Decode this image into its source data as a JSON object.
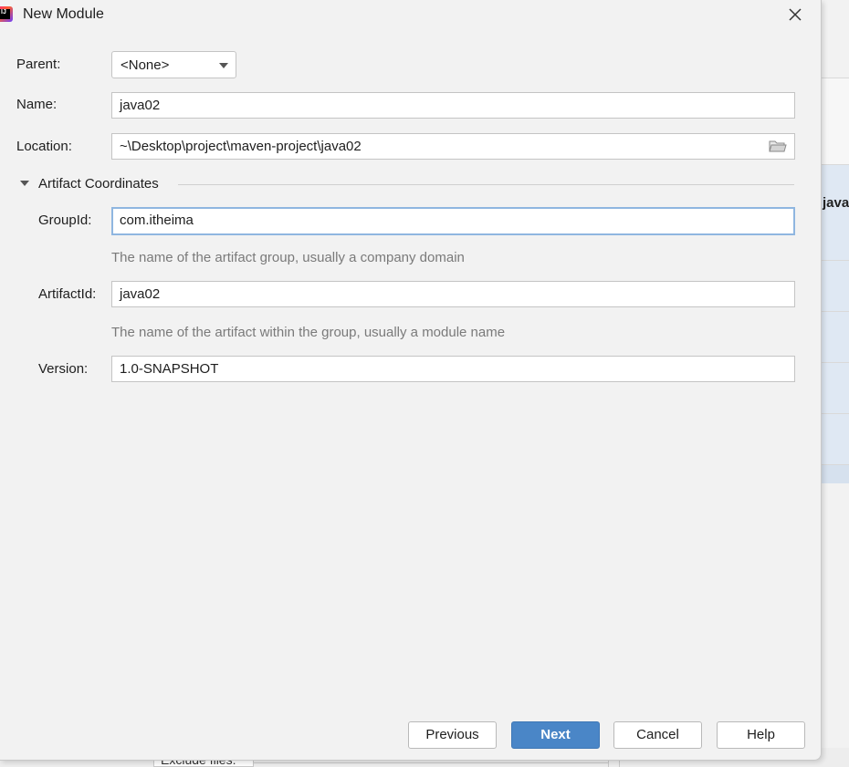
{
  "window": {
    "title": "New Module"
  },
  "form": {
    "parent": {
      "label": "Parent:",
      "value": "<None>"
    },
    "name": {
      "label": "Name:",
      "value": "java02"
    },
    "location": {
      "label": "Location:",
      "value": "~\\Desktop\\project\\maven-project\\java02"
    }
  },
  "artifact": {
    "section_label": "Artifact Coordinates",
    "group_id": {
      "label": "GroupId:",
      "value": "com.itheima",
      "hint": "The name of the artifact group, usually a company domain"
    },
    "artifact_id": {
      "label": "ArtifactId:",
      "value": "java02",
      "hint": "The name of the artifact within the group, usually a module name"
    },
    "version": {
      "label": "Version:",
      "value": "1.0-SNAPSHOT"
    }
  },
  "buttons": {
    "previous": "Previous",
    "next": "Next",
    "cancel": "Cancel",
    "help": "Help"
  },
  "background": {
    "partial_text": "java",
    "bottom_label": "Exclude files:"
  },
  "colors": {
    "primary_button": "#4a86c7",
    "focus_border": "#8fb6e0",
    "hint_text": "#7a7a7a"
  },
  "icons": {
    "close": "close-icon",
    "folder": "folder-icon",
    "app": "intellij-idea-icon",
    "dropdown": "chevron-down-icon",
    "collapse": "triangle-down-icon"
  }
}
